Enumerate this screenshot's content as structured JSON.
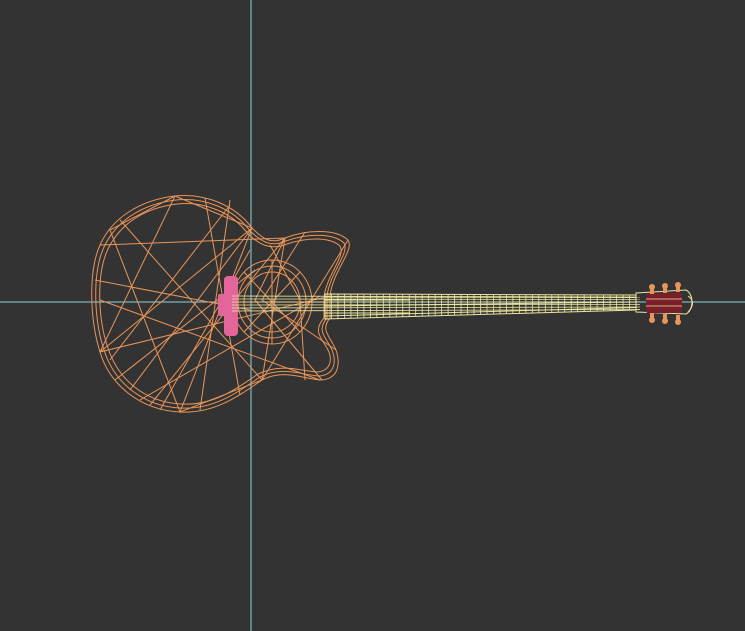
{
  "viewport": {
    "background": "#333333",
    "axis_color": "#8fd0d8"
  },
  "model": {
    "object": "acoustic-guitar-wireframe",
    "display_mode": "wireframe",
    "colors": {
      "body": "#e8955a",
      "neck": "#e9e6a0",
      "bridge": "#e3669a",
      "headstock_inner": "#7a1f2a",
      "tuners": "#e8955a"
    }
  }
}
